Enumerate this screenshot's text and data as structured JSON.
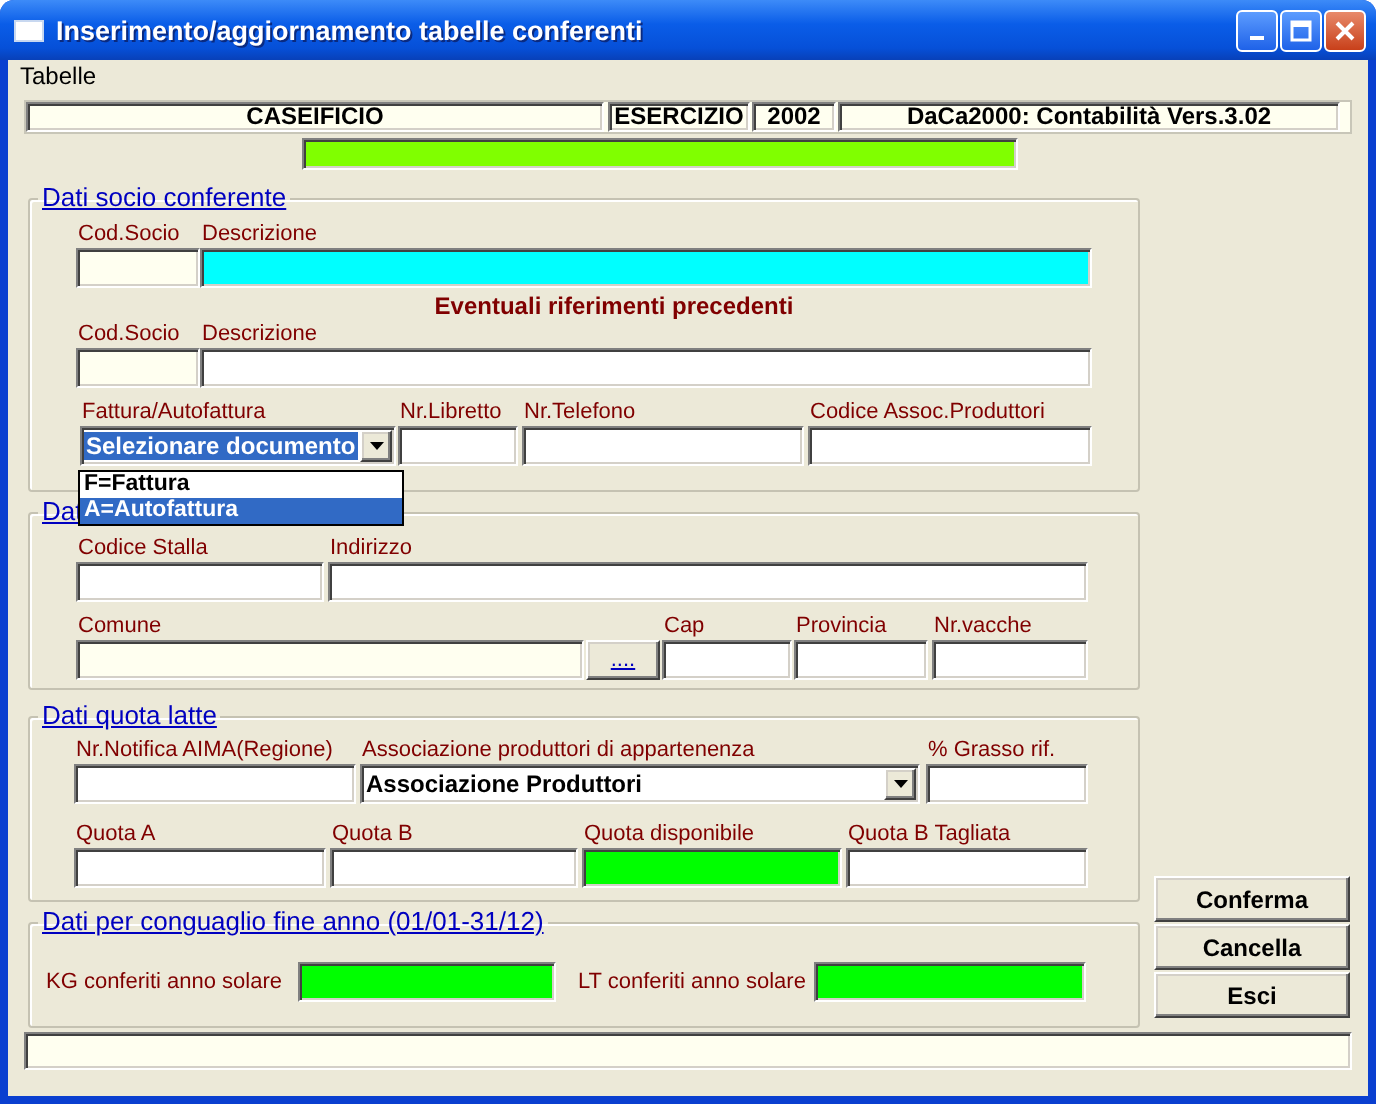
{
  "window": {
    "title": "Inserimento/aggiornamento tabelle conferenti"
  },
  "menu": [
    {
      "label": "Tabelle"
    }
  ],
  "header": [
    {
      "text": "CASEIFICIO"
    },
    {
      "text": "ESERCIZIO"
    },
    {
      "text": "2002"
    },
    {
      "text": "DaCa2000: Contabilità Vers.3.02"
    }
  ],
  "groups": [
    {
      "title": "Dati socio conferente",
      "rows": [
        {
          "kind": "fields",
          "fields": [
            {
              "label": "Cod.Socio",
              "color": "#fffff0"
            },
            {
              "label": "Descrizione",
              "color": "#00ffff"
            }
          ]
        },
        {
          "kind": "note",
          "text": "Eventuali riferimenti precedenti"
        },
        {
          "kind": "fields",
          "fields": [
            {
              "label": "Cod.Socio",
              "color": "#fffff0"
            },
            {
              "label": "Descrizione",
              "color": "#ffffff"
            }
          ]
        },
        {
          "kind": "fields",
          "fields": [
            {
              "kind": "combo",
              "label": "Fattura/Autofattura",
              "value": "Selezionare documento",
              "highlighted": true,
              "expanded": true,
              "options": [
                {
                  "label": "F=Fattura",
                  "selected": false
                },
                {
                  "label": "A=Autofattura",
                  "selected": true
                }
              ]
            },
            {
              "label": "Nr.Libretto",
              "color": "#ffffff"
            },
            {
              "label": "Nr.Telefono",
              "color": "#ffffff"
            },
            {
              "label": "Codice Assoc.Produttori",
              "color": "#ffffff"
            }
          ]
        }
      ]
    },
    {
      "title": "Dat",
      "rows": [
        {
          "kind": "fields",
          "fields": [
            {
              "label": "Codice Stalla",
              "color": "#ffffff"
            },
            {
              "label": "Indirizzo",
              "color": "#ffffff"
            }
          ]
        },
        {
          "kind": "fields",
          "fields": [
            {
              "kind": "browse",
              "label": "Comune",
              "color": "#fffff0",
              "button": "...."
            },
            {
              "label": "Cap",
              "color": "#ffffff"
            },
            {
              "label": "Provincia",
              "color": "#ffffff"
            },
            {
              "label": "Nr.vacche",
              "color": "#ffffff"
            }
          ]
        }
      ]
    },
    {
      "title": "Dati quota latte",
      "rows": [
        {
          "kind": "fields",
          "fields": [
            {
              "label": "Nr.Notifica AIMA(Regione)",
              "color": "#ffffff"
            },
            {
              "kind": "combo",
              "label": "Associazione produttori di appartenenza",
              "value": "Associazione Produttori",
              "highlighted": false,
              "expanded": false
            },
            {
              "label": "% Grasso rif.",
              "color": "#ffffff"
            }
          ]
        },
        {
          "kind": "fields",
          "fields": [
            {
              "label": "Quota A",
              "color": "#ffffff"
            },
            {
              "label": "Quota B",
              "color": "#ffffff"
            },
            {
              "label": "Quota disponibile",
              "color": "#00ff00"
            },
            {
              "label": "Quota B Tagliata",
              "color": "#ffffff"
            }
          ]
        }
      ]
    },
    {
      "title": "Dati per conguaglio fine anno (01/01-31/12)",
      "rows": [
        {
          "kind": "inline",
          "fields": [
            {
              "label": "KG conferiti anno solare",
              "color": "#00ff00"
            },
            {
              "label": "LT conferiti anno solare",
              "color": "#00ff00"
            }
          ]
        }
      ]
    }
  ],
  "buttons": [
    {
      "label": "Conferma"
    },
    {
      "label": "Cancella"
    },
    {
      "label": "Esci"
    }
  ]
}
